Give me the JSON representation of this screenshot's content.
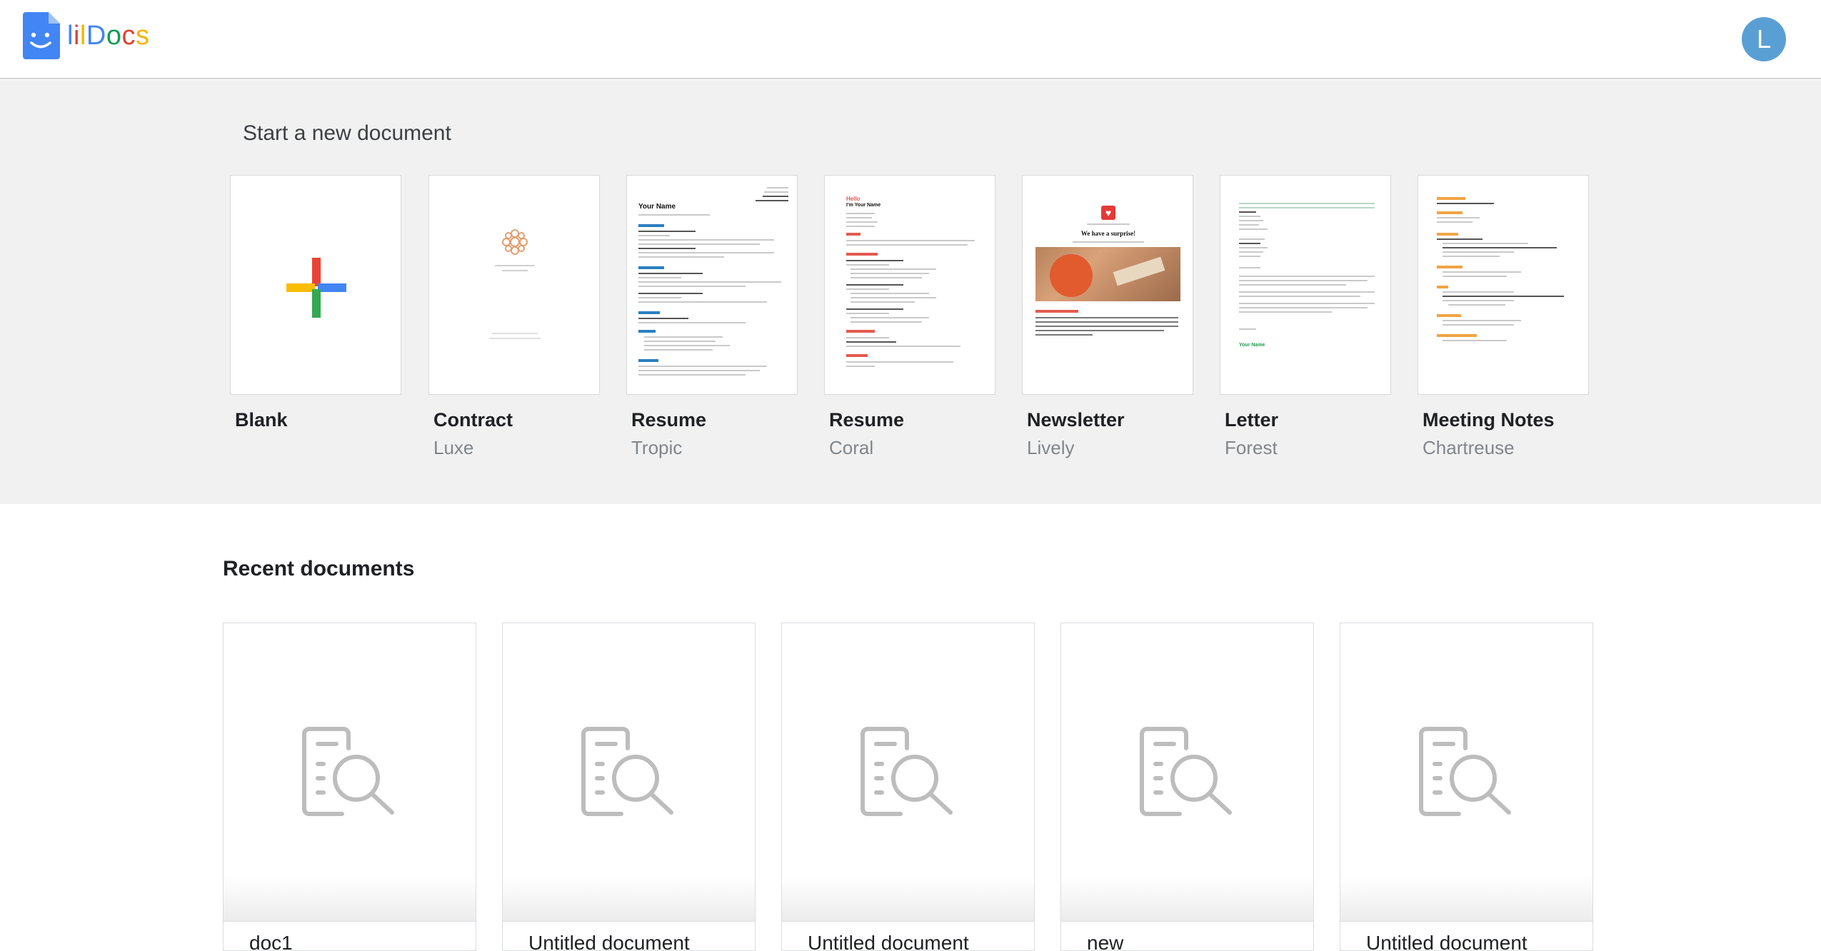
{
  "app": {
    "logo_text": "lilDocs",
    "logo_colors": [
      "#4285f4",
      "#db4437",
      "#f4b400",
      "#4285f4",
      "#0f9d58",
      "#db4437",
      "#f4b400"
    ],
    "avatar_letter": "L",
    "avatar_color": "#5a9fd4"
  },
  "templates": {
    "title": "Start a new document",
    "items": [
      {
        "name": "Blank",
        "style": ""
      },
      {
        "name": "Contract",
        "style": "Luxe"
      },
      {
        "name": "Resume",
        "style": "Tropic"
      },
      {
        "name": "Resume",
        "style": "Coral"
      },
      {
        "name": "Newsletter",
        "style": "Lively"
      },
      {
        "name": "Letter",
        "style": "Forest"
      },
      {
        "name": "Meeting Notes",
        "style": "Chartreuse"
      }
    ],
    "thumb_text": {
      "resume_tropic_name": "Your Name",
      "resume_coral_hello": "Hello",
      "resume_coral_name": "I'm Your Name",
      "newsletter_headline": "We have a surprise!",
      "letter_signature": "Your Name"
    }
  },
  "recent": {
    "title": "Recent documents",
    "documents": [
      {
        "title": "doc1"
      },
      {
        "title": "Untitled document"
      },
      {
        "title": "Untitled document"
      },
      {
        "title": "new"
      },
      {
        "title": "Untitled document"
      }
    ]
  },
  "icons": {
    "logo": "docs-logo-icon",
    "blank_plus": "plus-icon",
    "doc_preview": "document-search-icon"
  }
}
